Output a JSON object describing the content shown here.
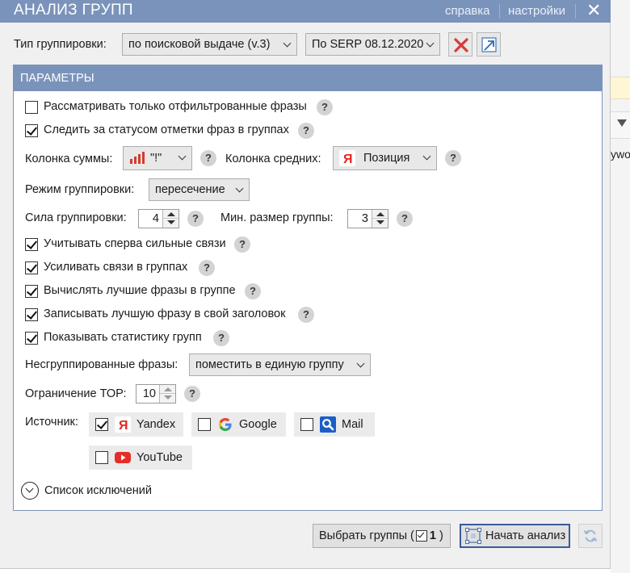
{
  "window": {
    "title": "АНАЛИЗ ГРУПП",
    "help_link": "справка",
    "settings_link": "настройки",
    "close_glyph": "✕"
  },
  "grouping_type": {
    "label": "Тип группировки:",
    "value": "по поисковой выдаче (v.3)",
    "serp_value": "По SERP 08.12.2020"
  },
  "panel": {
    "title": "ПАРАМЕТРЫ"
  },
  "options": {
    "filtered_only": {
      "label": "Рассматривать только отфильтрованные фразы",
      "checked": false
    },
    "track_marks": {
      "label": "Следить за статусом отметки фраз в группах",
      "checked": true
    }
  },
  "columns": {
    "sum_label": "Колонка суммы:",
    "sum_value": "\"!\"",
    "avg_label": "Колонка средних:",
    "avg_value": "Позиция"
  },
  "mode": {
    "label": "Режим группировки:",
    "value": "пересечение"
  },
  "strength": {
    "label": "Сила группировки:",
    "value": "4",
    "min_size_label": "Мин. размер группы:",
    "min_size_value": "3"
  },
  "flags": [
    {
      "label": "Учитывать сперва сильные связи",
      "checked": true
    },
    {
      "label": "Усиливать связи в группах",
      "checked": true
    },
    {
      "label": "Вычислять лучшие фразы в группе",
      "checked": true
    },
    {
      "label": "Записывать лучшую фразу в свой заголовок",
      "checked": true
    },
    {
      "label": "Показывать статистику групп",
      "checked": true
    }
  ],
  "ungrouped": {
    "label": "Несгруппированные фразы:",
    "value": "поместить в единую группу"
  },
  "top_limit": {
    "label": "Ограничение ТОР:",
    "value": "10"
  },
  "sources": {
    "label": "Источник:",
    "items": [
      {
        "name": "Yandex",
        "checked": true,
        "icon": "yandex-icon"
      },
      {
        "name": "Google",
        "checked": false,
        "icon": "google-icon"
      },
      {
        "name": "Mail",
        "checked": false,
        "icon": "mail-search-icon"
      },
      {
        "name": "YouTube",
        "checked": false,
        "icon": "youtube-icon"
      }
    ]
  },
  "exclusions": {
    "label": "Список исключений"
  },
  "footer": {
    "select_groups_label": "Выбрать группы (",
    "select_groups_count": "1",
    "select_groups_close": ")",
    "start_label": "Начать анализ"
  },
  "help_glyph": "?",
  "background": {
    "cell_text": "ywo"
  },
  "colors": {
    "accent": "#7a93bb",
    "dialog_bg": "#f0f0f0",
    "close_red": "#d93a3a",
    "yandex_red": "#e52620",
    "youtube_red": "#e52d27",
    "mail_blue": "#1b5ec9"
  }
}
